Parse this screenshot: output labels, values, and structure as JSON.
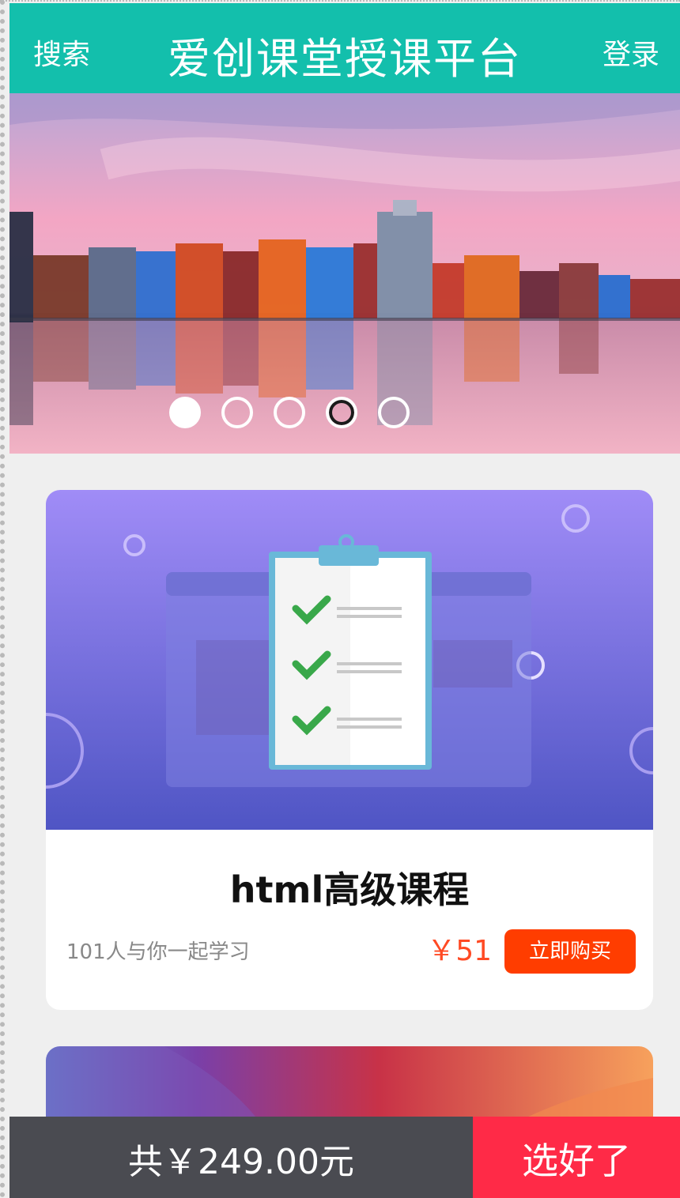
{
  "header": {
    "search_label": "搜索",
    "title": "爱创课堂授课平台",
    "login_label": "登录"
  },
  "banner": {
    "image": "colorful-waterfront-houses-at-sunset",
    "slides": 5,
    "active_slide": 1,
    "highlighted_slide": 4
  },
  "courses": [
    {
      "title": "html高级课程",
      "learners": "101人与你一起学习",
      "price": "￥51",
      "buy_label": "立即购买",
      "image": "clipboard-checklist-illustration"
    },
    {
      "image": "abstract-gradient-illustration"
    }
  ],
  "footer": {
    "total": "共￥249.00元",
    "done_label": "选好了"
  },
  "colors": {
    "header": "#13bfac",
    "price": "#ff4a24",
    "buy_button": "#ff3d00",
    "footer_total": "#4a4b51",
    "footer_done": "#ff2a47"
  }
}
